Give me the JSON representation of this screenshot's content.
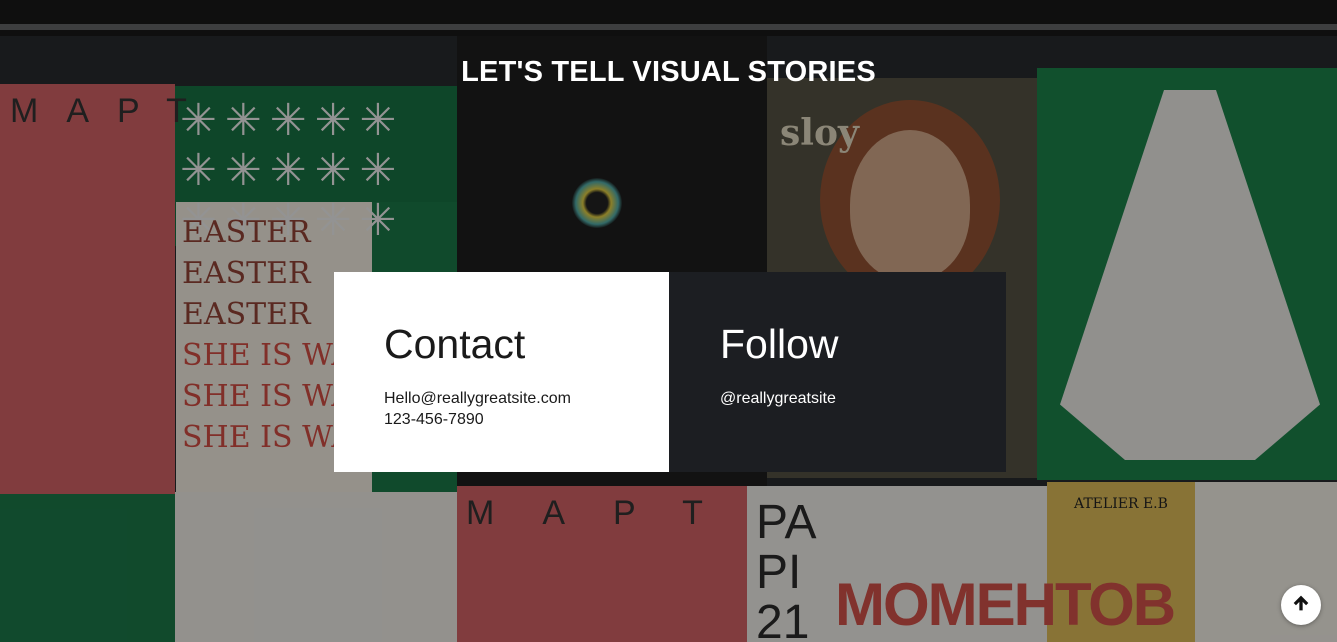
{
  "hero": {
    "heading": "LET'S TELL VISUAL STORIES"
  },
  "contact": {
    "title": "Contact",
    "email": "Hello@reallygreatsite.com",
    "phone": "123-456-7890"
  },
  "follow": {
    "title": "Follow",
    "handle": "@reallygreatsite"
  },
  "scroll_top": {
    "icon": "arrow-up-icon"
  },
  "colors": {
    "contact_card_bg": "#ffffff",
    "follow_card_bg": "#1c1e22",
    "heading_text": "#ffffff"
  }
}
